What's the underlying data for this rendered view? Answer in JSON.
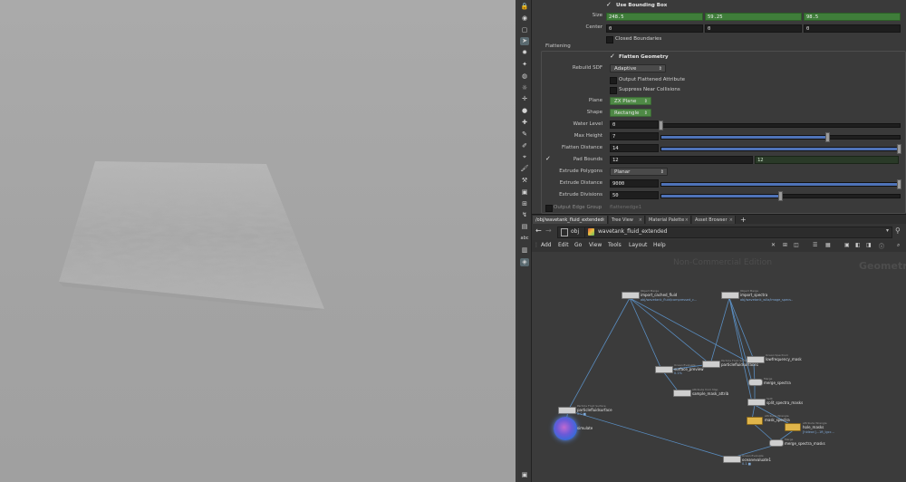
{
  "params": {
    "use_bounding_box": {
      "label": "Use Bounding Box",
      "checked": true
    },
    "size": {
      "label": "Size",
      "values": [
        "248.5",
        "59.25",
        "98.5"
      ]
    },
    "center": {
      "label": "Center",
      "values": [
        "0",
        "0",
        "0"
      ]
    },
    "closed_boundaries": {
      "label": "Closed Boundaries",
      "checked": false
    },
    "section_title": "Flattening",
    "flatten_geometry": {
      "label": "Flatten Geometry",
      "checked": true
    },
    "rebuild_sdf": {
      "label": "Rebuild SDF",
      "value": "Adaptive"
    },
    "output_flattened": {
      "label": "Output Flattened Attribute",
      "checked": false
    },
    "suppress_near": {
      "label": "Suppress Near Collisions",
      "checked": false
    },
    "plane": {
      "label": "Plane",
      "value": "ZX Plane"
    },
    "shape": {
      "label": "Shape",
      "value": "Rectangle"
    },
    "water_level": {
      "label": "Water Level",
      "value": "0",
      "fraction": 0.0
    },
    "max_height": {
      "label": "Max Height",
      "value": "7",
      "fraction": 0.7
    },
    "flatten_distance": {
      "label": "Flatten Distance",
      "value": "14",
      "fraction": 1.0
    },
    "pad_bounds": {
      "label": "Pad Bounds",
      "values": [
        "12",
        "12"
      ],
      "checked": true
    },
    "extrude_polygons": {
      "label": "Extrude Polygons",
      "value": "Planar"
    },
    "extrude_distance": {
      "label": "Extrude Distance",
      "value": "9000",
      "fraction": 1.0
    },
    "extrude_divisions": {
      "label": "Extrude Divisions",
      "value": "50",
      "fraction": 0.5
    },
    "output_edge_group": {
      "label": "Output Edge Group",
      "extra": "flattenedge1"
    }
  },
  "tabs": [
    {
      "label": "/obj/wavetank_fluid_extended",
      "active": true
    },
    {
      "label": "Tree View",
      "active": false
    },
    {
      "label": "Material Palette",
      "active": false
    },
    {
      "label": "Asset Browser",
      "active": false
    },
    {
      "label": "+",
      "active": false
    }
  ],
  "path": {
    "root": "obj",
    "current": "wavetank_fluid_extended"
  },
  "menu": [
    "Add",
    "Edit",
    "Go",
    "View",
    "Tools",
    "Layout",
    "Help"
  ],
  "network": {
    "watermark": "Non-Commercial Edition",
    "context_label": "Geometry",
    "nodes": [
      {
        "id": "import_cached_fluid",
        "type": "Object Merge",
        "name": "import_cached_fluid",
        "sub": "obj/wavetank_fluid/compressed_c...",
        "kind": "white"
      },
      {
        "id": "import_spectra",
        "type": "Object Merge",
        "name": "import_spectra",
        "sub": "obj/wavetank_wlla/image_specs..",
        "kind": "white"
      },
      {
        "id": "surface_preview",
        "type": "Ocean Evaluate",
        "name": "surface_preview",
        "sub": "0.1%",
        "kind": "white"
      },
      {
        "id": "particlefluidsurface1",
        "type": "Particle Fluid Surface",
        "name": "particlefluidsurface1",
        "sub": "",
        "kind": "white"
      },
      {
        "id": "filter_spectra",
        "type": "Ocean Spectrum",
        "name": "lowfrequency_mask",
        "sub": "",
        "kind": "white"
      },
      {
        "id": "merge_spectra",
        "type": "Merge",
        "name": "merge_spectra",
        "sub": "",
        "kind": "merge"
      },
      {
        "id": "sample_mask_attrib",
        "type": "Attribute from Map",
        "name": "sample_mask_attrib",
        "sub": "",
        "kind": "white"
      },
      {
        "id": "split_spectra_masks",
        "type": "Split",
        "name": "split_spectra_masks",
        "sub": "",
        "kind": "white"
      },
      {
        "id": "mask_spectra",
        "type": "Attribute Wrangle",
        "name": "mask_spectra",
        "sub": "",
        "kind": "yellow"
      },
      {
        "id": "hole_masks",
        "type": "Attribute Wrangle",
        "name": "hole_masks",
        "sub": "[hideon]...1ft_lgcc...",
        "kind": "yellow"
      },
      {
        "id": "merge_spectra_masks",
        "type": "Merge",
        "name": "merge_spectra_masks",
        "sub": "",
        "kind": "merge"
      },
      {
        "id": "particlefluidsurface_sdf",
        "type": "Particle Fluid Surface",
        "name": "particlefluidsurface",
        "sub": "0.0 ■",
        "kind": "white"
      },
      {
        "id": "simulate",
        "type": "",
        "name": "simulate",
        "sub": "",
        "kind": "ball"
      },
      {
        "id": "oceanevaluate1",
        "type": "Ocean Evaluate",
        "name": "oceanevaluate1",
        "sub": "0.1 ■",
        "kind": "white"
      }
    ]
  },
  "colors": {
    "accent_green": "#4f8a46",
    "slider_blue": "#4f73b8",
    "wire": "#5a8ec2",
    "viewport_bg": "#a6a6a6"
  },
  "toolbar_icons": [
    "lock-icon",
    "camera-icon",
    "bounds-icon",
    "select-icon",
    "light-icon",
    "point-light-icon",
    "spot-light-icon",
    "env-light-icon",
    "handle-icon",
    "sphere-icon",
    "add-point-icon",
    "brush-icon",
    "edit-icon",
    "pose-icon",
    "paint-icon",
    "sculpt-icon",
    "box-icon",
    "snap-icon",
    "warp-icon",
    "fill-icon",
    "text-icon",
    "render-icon",
    "display-icon"
  ]
}
